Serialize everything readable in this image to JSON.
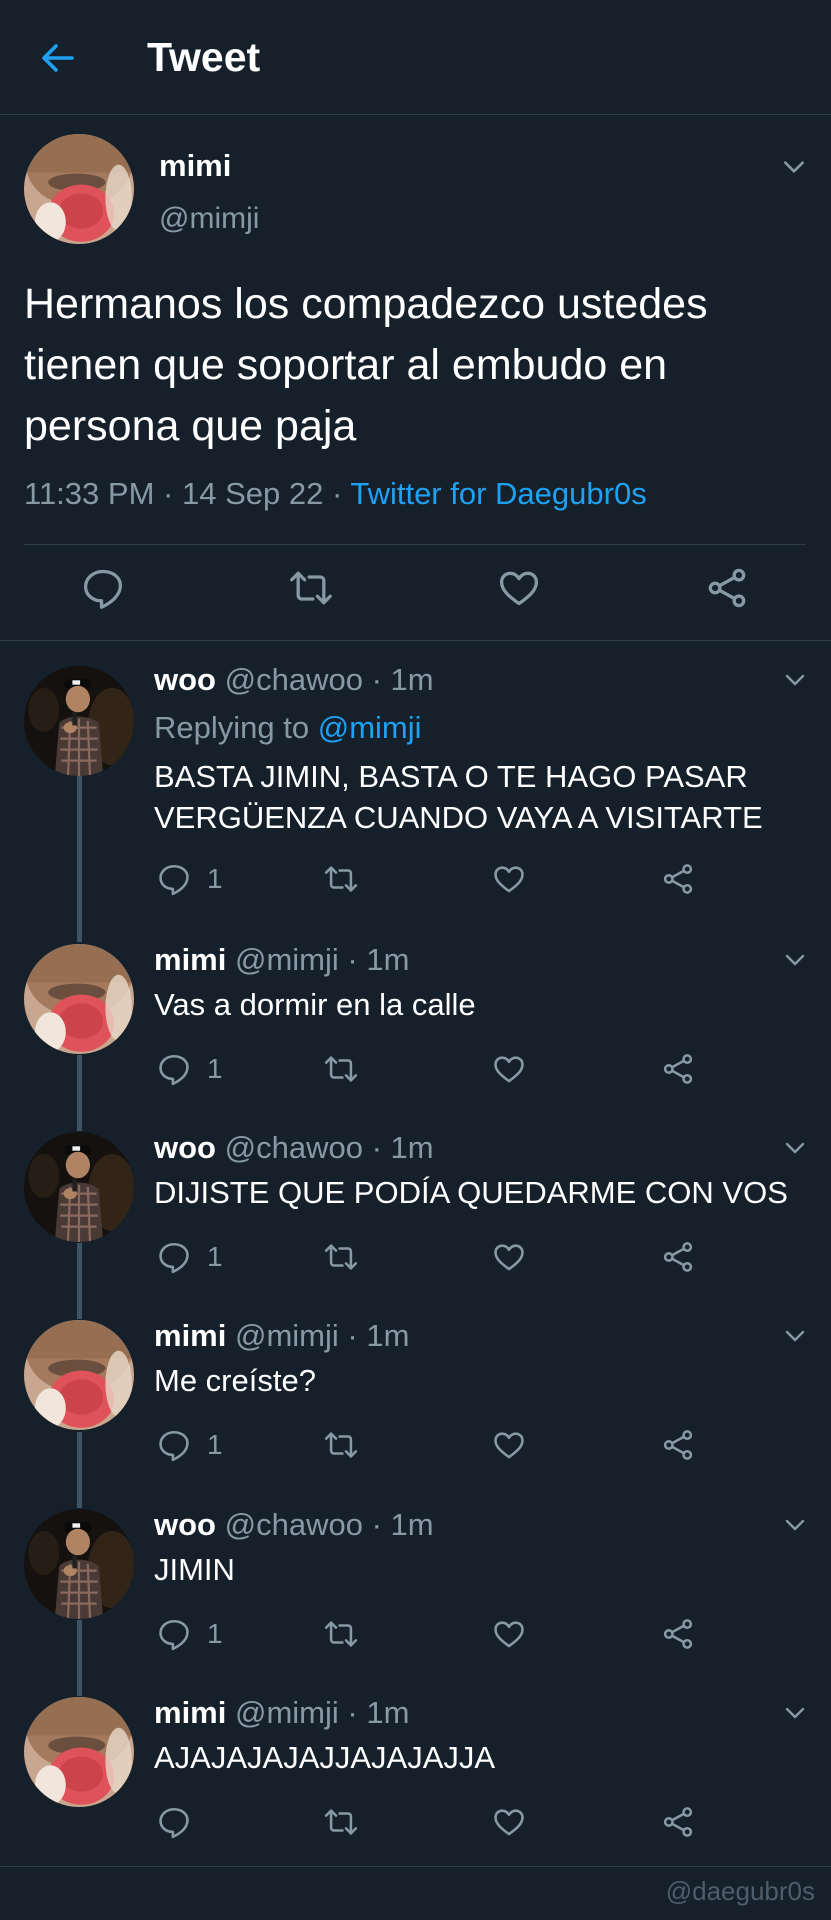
{
  "header": {
    "title": "Tweet"
  },
  "main_tweet": {
    "name": "mimi",
    "handle": "@mimji",
    "text": "Hermanos los compadezco ustedes tienen que soportar al embudo en persona que paja",
    "time": "11:33 PM",
    "date": "14 Sep 22",
    "source": "Twitter for Daegubr0s"
  },
  "replies": [
    {
      "name": "woo",
      "handle": "@chawoo",
      "time": "1m",
      "replying_label": "Replying to",
      "replying_to": "@mimji",
      "text": "BASTA JIMIN, BASTA O TE HAGO PASAR VERGÜENZA CUANDO VAYA A VISITARTE",
      "reply_count": "1"
    },
    {
      "name": "mimi",
      "handle": "@mimji",
      "time": "1m",
      "text": "Vas a dormir en la calle",
      "reply_count": "1"
    },
    {
      "name": "woo",
      "handle": "@chawoo",
      "time": "1m",
      "text": "DIJISTE QUE PODÍA QUEDARME CON VOS",
      "reply_count": "1"
    },
    {
      "name": "mimi",
      "handle": "@mimji",
      "time": "1m",
      "text": "Me creíste?",
      "reply_count": "1"
    },
    {
      "name": "woo",
      "handle": "@chawoo",
      "time": "1m",
      "text": "JIMIN",
      "reply_count": "1"
    },
    {
      "name": "mimi",
      "handle": "@mimji",
      "time": "1m",
      "text": "AJAJAJAJAJJAJAJAJJA",
      "reply_count": ""
    }
  ],
  "separator": "·",
  "watermark": "@daegubr0s",
  "colors": {
    "background": "#15202b",
    "accent": "#1da1f2",
    "muted": "#8899a6",
    "divider": "#2f3c48",
    "thread_line": "#3d5466"
  },
  "icons": [
    "back-arrow-icon",
    "chevron-down-icon",
    "reply-icon",
    "retweet-icon",
    "like-icon",
    "share-icon"
  ]
}
